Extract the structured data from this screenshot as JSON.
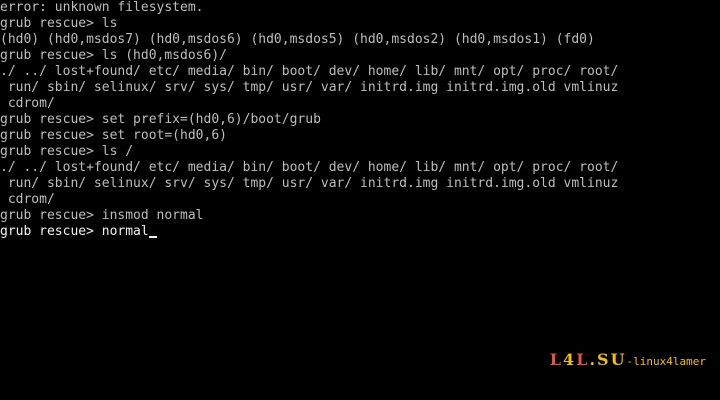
{
  "console": {
    "lines": [
      "error: unknown filesystem.",
      "grub rescue> ls",
      "(hd0) (hd0,msdos7) (hd0,msdos6) (hd0,msdos5) (hd0,msdos2) (hd0,msdos1) (fd0)",
      "grub rescue> ls (hd0,msdos6)/",
      "./ ../ lost+found/ etc/ media/ bin/ boot/ dev/ home/ lib/ mnt/ opt/ proc/ root/",
      " run/ sbin/ selinux/ srv/ sys/ tmp/ usr/ var/ initrd.img initrd.img.old vmlinuz",
      " cdrom/",
      "grub rescue> set prefix=(hd0,6)/boot/grub",
      "grub rescue> set root=(hd0,6)",
      "grub rescue> ls /",
      "./ ../ lost+found/ etc/ media/ bin/ boot/ dev/ home/ lib/ mnt/ opt/ proc/ root/",
      " run/ sbin/ selinux/ srv/ sys/ tmp/ usr/ var/ initrd.img initrd.img.old vmlinuz",
      " cdrom/",
      "grub rescue> insmod normal"
    ],
    "prompt": "grub rescue> ",
    "current_input": "normal"
  },
  "watermark": {
    "logo_parts": [
      "L",
      "4",
      "L",
      ".SU"
    ],
    "tagline": "-linux4lamer"
  },
  "colors": {
    "background": "#000000",
    "text": "#bdbdbd",
    "logo_red": "#e8533a",
    "logo_yellow": "#f3c000"
  }
}
